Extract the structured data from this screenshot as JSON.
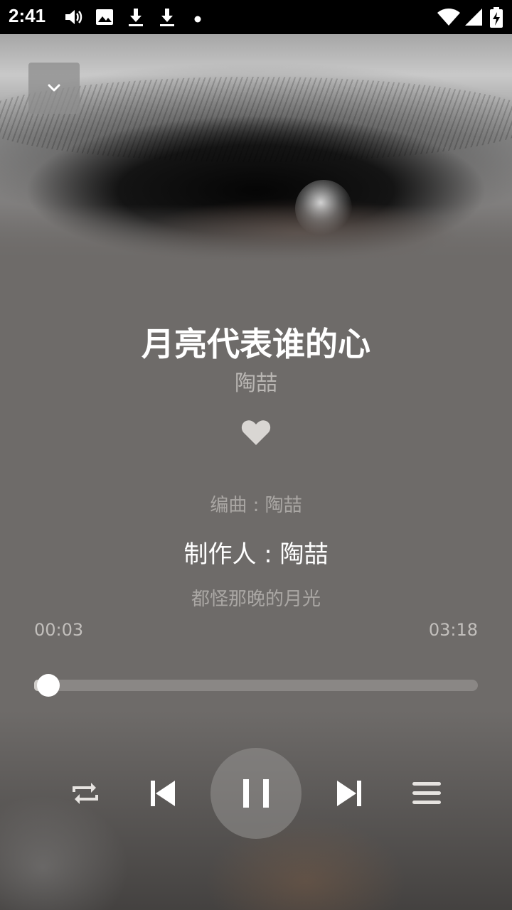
{
  "status_bar": {
    "time": "2:41",
    "left_icons": [
      "volume-icon",
      "image-icon",
      "download-icon",
      "download-icon",
      "dot-icon"
    ],
    "right_icons": [
      "wifi-icon",
      "signal-icon",
      "battery-charging-icon"
    ]
  },
  "player": {
    "song_title": "月亮代表谁的心",
    "artist": "陶喆",
    "liked": true,
    "lyrics": {
      "previous": "编曲 : 陶喆",
      "current": "制作人 : 陶喆",
      "next": "都怪那晚的月光"
    },
    "time_elapsed": "00:03",
    "time_total": "03:18",
    "progress": 0.016
  },
  "controls": {
    "icons": [
      "repeat-icon",
      "previous-icon",
      "pause-icon",
      "next-icon",
      "playlist-icon"
    ],
    "state": "playing"
  },
  "colors": {
    "background": "#6e6b69",
    "title": "#ffffff",
    "secondary_text": "#b9b6b3",
    "heart": "#d9d6d3"
  }
}
